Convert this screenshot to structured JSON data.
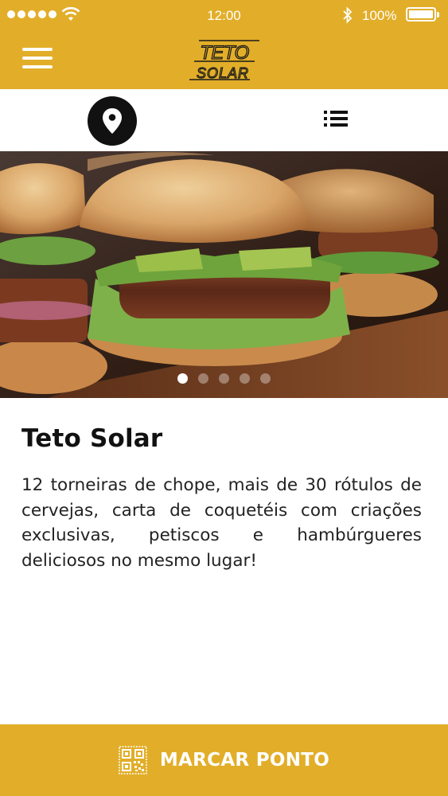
{
  "status_bar": {
    "time": "12:00",
    "battery_percent": "100%",
    "icons": [
      "signal-dots-icon",
      "wifi-icon",
      "bluetooth-icon",
      "battery-icon"
    ]
  },
  "header": {
    "logo_line1": "TETO",
    "logo_line2": "SOLAR",
    "menu_icon": "hamburger-menu-icon",
    "background_color": "#e2ae29"
  },
  "tabs": [
    {
      "icon": "map-pin-icon",
      "active": true
    },
    {
      "icon": "list-icon",
      "active": false
    }
  ],
  "carousel": {
    "slide_count": 5,
    "active_index": 0
  },
  "venue": {
    "name": "Teto Solar",
    "description": "12 torneiras de chope, mais de 30 rótulos de cervejas, carta de coquetéis com criações exclusivas, petiscos e hambúrgueres deliciosos no mesmo lugar!"
  },
  "action": {
    "label": "MARCAR PONTO",
    "icon": "qr-code-icon"
  }
}
